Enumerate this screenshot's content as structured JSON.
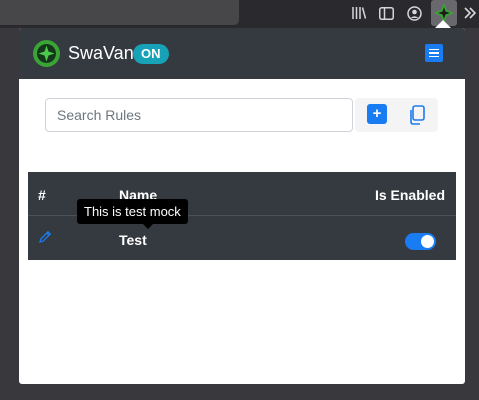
{
  "header": {
    "brand": "SwaVan",
    "status_badge": "ON"
  },
  "search": {
    "placeholder": "Search Rules",
    "value": ""
  },
  "table": {
    "columns": [
      "#",
      "Name",
      "Is Enabled"
    ],
    "rows": [
      {
        "name": "Test",
        "enabled": true
      }
    ]
  },
  "tooltip": {
    "text": "This is test mock"
  },
  "colors": {
    "primary": "#1a7cf2",
    "badge": "#17a2b8",
    "dark": "#343a40",
    "logo_green": "#3aa535"
  }
}
